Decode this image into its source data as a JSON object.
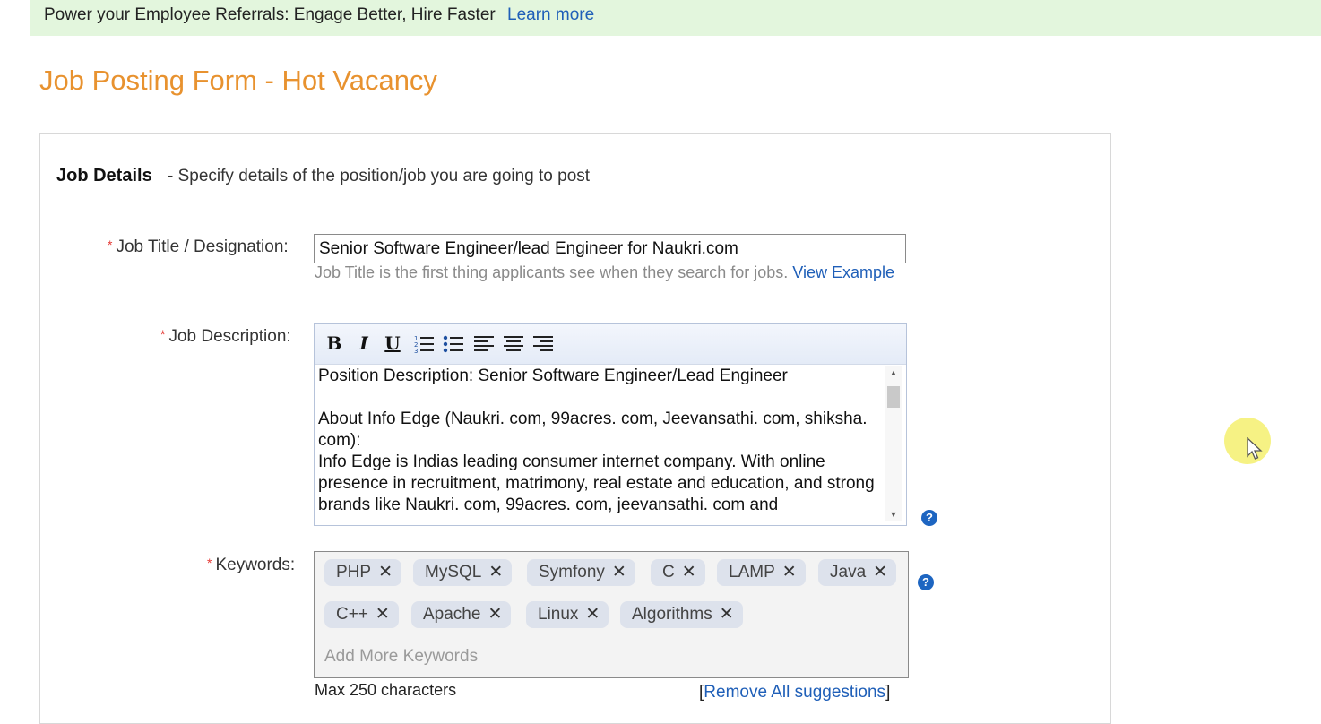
{
  "banner": {
    "text": "Power your Employee Referrals: Engage Better, Hire Faster",
    "link": "Learn more"
  },
  "page_title": "Job Posting Form - Hot Vacancy",
  "section": {
    "title": "Job Details",
    "subtitle": "- Specify details of the position/job you are going to post"
  },
  "job_title": {
    "label": "Job Title / Designation:",
    "value": "Senior Software Engineer/lead Engineer for Naukri.com",
    "hint": "Job Title is the first thing applicants see when they search for jobs.",
    "hint_link": "View Example"
  },
  "job_description": {
    "label": "Job Description:",
    "toolbar": {
      "bold": "B",
      "italic": "I",
      "underline": "U"
    },
    "lines": [
      "Position Description: Senior Software Engineer/Lead Engineer",
      "About Info Edge (Naukri. com, 99acres. com, Jeevansathi. com, shiksha. com):",
      "Info Edge is Indias leading consumer internet company. With online presence in recruitment, matrimony, real estate and education, and strong brands like Naukri. com, 99acres. com, jeevansathi. com and"
    ]
  },
  "keywords": {
    "label": "Keywords:",
    "chips": [
      "PHP",
      "MySQL",
      "Symfony",
      "C",
      "LAMP",
      "Java",
      "C++",
      "Apache",
      "Linux",
      "Algorithms"
    ],
    "placeholder": "Add More Keywords",
    "max": "Max 250 characters",
    "remove_all": "Remove All suggestions"
  },
  "required_marker": "*",
  "help_glyph": "?",
  "remove_glyph": "✕",
  "accent_color": "#e8922f",
  "link_color": "#1f5fb8"
}
